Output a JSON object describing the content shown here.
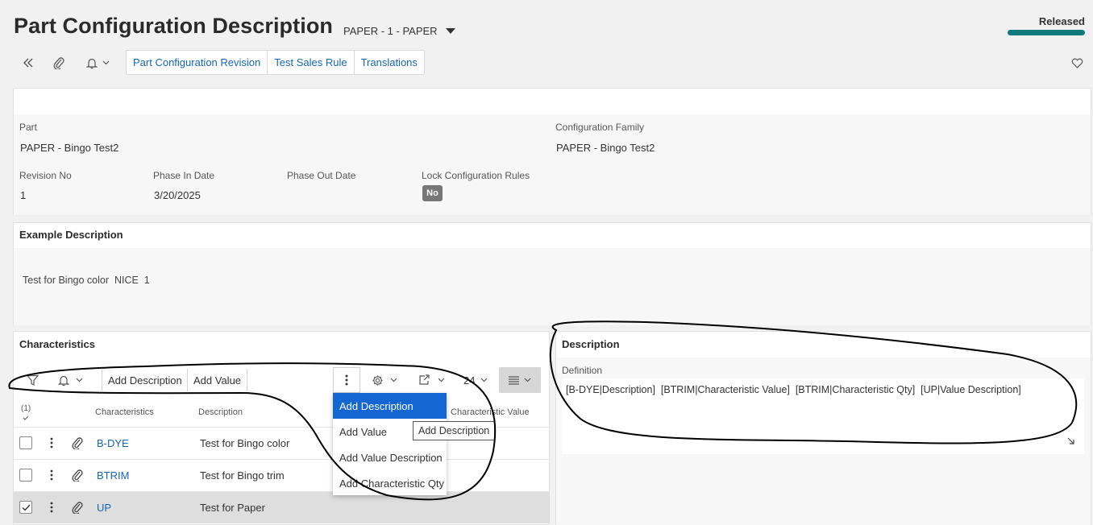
{
  "header": {
    "title": "Part Configuration Description",
    "record": "PAPER - 1 - PAPER",
    "status": "Released",
    "status_color": "#117a7c"
  },
  "toolbar": {
    "icons": [
      "double-chevron-left-icon",
      "paperclip-icon",
      "bell-icon",
      "heart-icon"
    ],
    "commands": [
      "Part Configuration Revision",
      "Test Sales Rule",
      "Translations"
    ]
  },
  "part": {
    "part_label": "Part",
    "part_value": "PAPER - Bingo Test2",
    "family_label": "Configuration Family",
    "family_value": "PAPER - Bingo Test2",
    "revision_label": "Revision No",
    "revision_value": "1",
    "phase_in_label": "Phase In Date",
    "phase_in_value": "3/20/2025",
    "phase_out_label": "Phase Out Date",
    "phase_out_value": "",
    "lock_label": "Lock Configuration Rules",
    "lock_value": "No"
  },
  "example": {
    "title": "Example Description",
    "text": "Test for Bingo color  NICE  1"
  },
  "characteristics": {
    "title": "Characteristics",
    "add_description": "Add Description",
    "add_value": "Add Value",
    "page_size": "24",
    "selected_count": "(1)",
    "columns": [
      "Characteristics",
      "Description",
      "Characteristic Value"
    ],
    "rows": [
      {
        "code": "B-DYE",
        "description": "Test for Bingo color",
        "checked": false
      },
      {
        "code": "BTRIM",
        "description": "Test for Bingo trim",
        "checked": false
      },
      {
        "code": "UP",
        "description": "Test for Paper",
        "checked": true
      }
    ]
  },
  "dropdown": {
    "items": [
      "Add Description",
      "Add Value",
      "Add Value Description",
      "Add Characteristic Qty"
    ],
    "tooltip": "Add Description"
  },
  "description": {
    "title": "Description",
    "definition_label": "Definition",
    "definition_value": "[B-DYE|Description]  [BTRIM|Characteristic Value]  [BTRIM|Characteristic Qty]  [UP|Value Description]"
  },
  "colors": {
    "link": "#1466b8",
    "menu_highlight": "#1466d2"
  }
}
